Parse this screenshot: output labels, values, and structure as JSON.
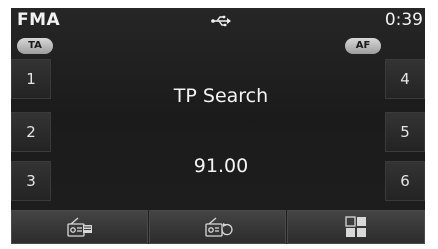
{
  "status": {
    "band": "FMA",
    "time": "0:39",
    "usb_icon": "usb-icon"
  },
  "pills": {
    "ta": "TA",
    "af": "AF"
  },
  "presets": {
    "left": [
      "1",
      "2",
      "3"
    ],
    "right": [
      "4",
      "5",
      "6"
    ]
  },
  "main": {
    "message": "TP Search",
    "frequency": "91.00"
  },
  "toolbar": {
    "icons": [
      "radio-list-icon",
      "radio-scan-icon",
      "menu-grid-icon"
    ]
  }
}
